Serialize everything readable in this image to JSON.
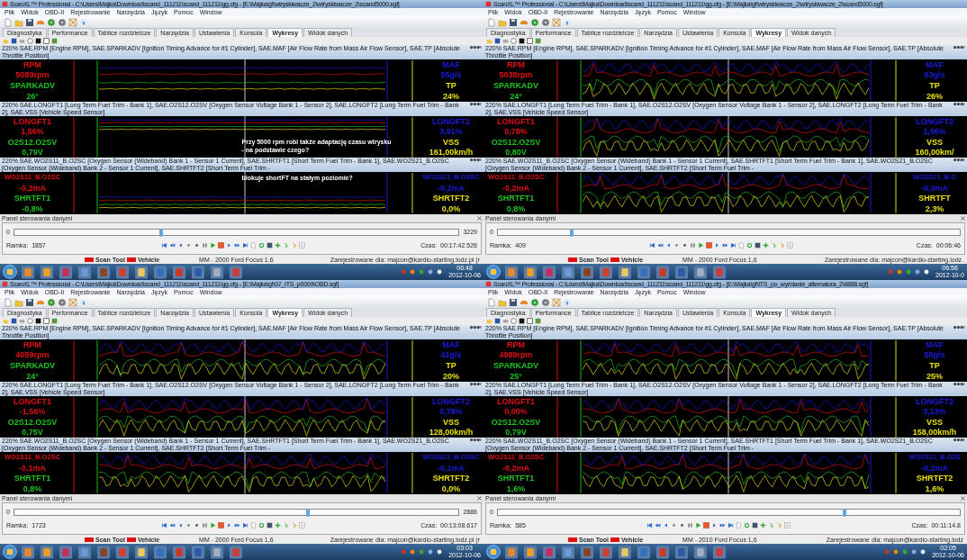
{
  "screens": [
    {
      "title": "ScanXL™ Professional - C:\\Users\\Majka\\Download\\scand_111211\\scand_111211\\gg.cfg - [E:\\Majka\\gf\\wtryskiwacze_2\\wtryskiwacze_2\\scand5000.sgf]",
      "menu": [
        "Plik",
        "Widok",
        "OBD-II",
        "Rejestrowanie",
        "Narzędzia",
        "Język",
        "Pomoc",
        "Window"
      ],
      "tabs": [
        {
          "label": "Diagnostyka",
          "selected": false
        },
        {
          "label": "Performance",
          "selected": false
        },
        {
          "label": "Tablice rozdzielcze",
          "selected": false
        },
        {
          "label": "Narzędzia",
          "selected": false
        },
        {
          "label": "Ustawienia",
          "selected": false
        },
        {
          "label": "Konsola",
          "selected": false
        },
        {
          "label": "Wykresy",
          "selected": true
        },
        {
          "label": "Widok danych",
          "selected": false
        }
      ],
      "charts": [
        {
          "header": "220% SAE.RPM [Engine RPM], SAE.SPARKADV [Ignition Timing Advance for #1 Cylinder], SAE.MAF [Air Flow Rate from Mass Air Flow Sensor], SAE.TP [Absolute Throttle Position]",
          "left": [
            {
              "text": "RPM",
              "color": "#e01010"
            },
            {
              "text": "5089rpm",
              "color": "#e01010"
            },
            {
              "text": "SPARKADV",
              "color": "#20c020"
            },
            {
              "text": "26°",
              "color": "#20c020"
            }
          ],
          "right": [
            {
              "text": "MAF",
              "color": "#1a1ae0"
            },
            {
              "text": "55g/s",
              "color": "#1a1ae0"
            },
            {
              "text": "TP",
              "color": "#e8e010"
            },
            {
              "text": "24%",
              "color": "#e8e010"
            }
          ]
        },
        {
          "header": "220% SAE.LONGFT1 [Long Term Fuel Trim - Bank 1], SAE.O2S12.O2SV [Oxygen Sensor Voltage Bank 1 - Sensor 2], SAE.LONGFT2 [Long Term Fuel Trim - Bank 2], SAE.VSS [Vehicle Speed Sensor]",
          "left": [
            {
              "text": "LONGFT1",
              "color": "#e01010"
            },
            {
              "text": "1,56%",
              "color": "#e01010"
            },
            {
              "text": "O2S12.O2SV",
              "color": "#20c020"
            },
            {
              "text": "0,79V",
              "color": "#20c020"
            }
          ],
          "right": [
            {
              "text": "LONGFT2",
              "color": "#1a1ae0"
            },
            {
              "text": "3,91%",
              "color": "#1a1ae0"
            },
            {
              "text": "VSS",
              "color": "#e8e010"
            },
            {
              "text": "161,00km/h",
              "color": "#e8e010"
            }
          ],
          "notes": [
            "Przy 5000 rpm robi także adaptację czasu wtrysku - na podstawie czego?"
          ]
        },
        {
          "header": "220% SAE.WO2S11_B.O2SC [Oxygen Sensor (Wideband) Bank 1 - Sensor 1 Current], SAE.SHRTFT1 [Short Term Fuel Trim - Bank 1], SAE.WO2S21_B.O2SC [Oxygen Sensor (Wideband) Bank 2 - Sensor 1 Current], SAE.SHRTFT2 [Short Term Fuel Trim -",
          "left": [
            {
              "text": "WO2S11_B.O2SC",
              "color": "#e01010"
            },
            {
              "text": "-0,2mA",
              "color": "#e01010"
            },
            {
              "text": "SHRTFT1",
              "color": "#20c020"
            },
            {
              "text": "-0,8%",
              "color": "#20c020"
            }
          ],
          "right": [
            {
              "text": "WO2S21_B.O2SC",
              "color": "#1a1ae0"
            },
            {
              "text": "-0,2mA",
              "color": "#1a1ae0"
            },
            {
              "text": "SHRTFT2",
              "color": "#e8e010"
            },
            {
              "text": "0,0%",
              "color": "#e8e010"
            }
          ],
          "notes": [
            "blokuje shortFT na stałym poziomie?"
          ]
        }
      ],
      "player": {
        "title": "Panel sterowania danymi",
        "min": "0",
        "max": "3229",
        "level": 0.33,
        "frame_label": "Ramka:",
        "frame": "1857",
        "time_label": "Czas:",
        "time": "00:17:42.526"
      },
      "status": {
        "legend": [
          "Scan Tool",
          "Vehicle"
        ],
        "vehicle": "MM - 2000 Ford Focus 1,6",
        "license": "Zarejestrowane dla: majcon@kardio-starting.lodz.pl (r"
      },
      "clock": {
        "time": "06:48",
        "date": "2012-10-06"
      }
    },
    {
      "title": "ScanXL™ Professional - C:\\Users\\Majka\\Download\\scand_111211\\scand_111211\\gg.cfg - [E:\\Majka\\gf\\wtryskiwacze_2\\wtryskiwacze_2\\scand5000.sgf]",
      "menu": [
        "Plik",
        "Widok",
        "OBD-II",
        "Rejestrowanie",
        "Narzędzia",
        "Język",
        "Pomoc",
        "Window"
      ],
      "tabs": [
        {
          "label": "Diagnostyka",
          "selected": false
        },
        {
          "label": "Performance",
          "selected": false
        },
        {
          "label": "Tablice rozdzielcze",
          "selected": false
        },
        {
          "label": "Narzędzia",
          "selected": false
        },
        {
          "label": "Ustawienia",
          "selected": false
        },
        {
          "label": "Konsola",
          "selected": false
        },
        {
          "label": "Wykresy",
          "selected": true
        },
        {
          "label": "Widok danych",
          "selected": false
        }
      ],
      "charts": [
        {
          "header": "220% SAE.RPM [Engine RPM], SAE.SPARKADV [Ignition Timing Advance for #1 Cylinder], SAE.MAF [Air Flow Rate from Mass Air Flow Sensor], SAE.TP [Absolute Throttle Position]",
          "left": [
            {
              "text": "RPM",
              "color": "#e01010"
            },
            {
              "text": "5038rpm",
              "color": "#e01010"
            },
            {
              "text": "SPARKADV",
              "color": "#20c020"
            },
            {
              "text": "24°",
              "color": "#20c020"
            }
          ],
          "right": [
            {
              "text": "MAF",
              "color": "#1a1ae0"
            },
            {
              "text": "63g/s",
              "color": "#1a1ae0"
            },
            {
              "text": "TP",
              "color": "#e8e010"
            },
            {
              "text": "26%",
              "color": "#e8e010"
            }
          ]
        },
        {
          "header": "220% SAE.LONGFT1 [Long Term Fuel Trim - Bank 1], SAE.O2S12.O2SV [Oxygen Sensor Voltage Bank 1 - Sensor 2], SAE.LONGFT2 [Long Term Fuel Trim - Bank 2], SAE.VSS [Vehicle Speed Sensor]",
          "left": [
            {
              "text": "LONGFT1",
              "color": "#e01010"
            },
            {
              "text": "0,78%",
              "color": "#e01010"
            },
            {
              "text": "O2S12.O2SV",
              "color": "#20c020"
            },
            {
              "text": "0,80V",
              "color": "#20c020"
            }
          ],
          "right": [
            {
              "text": "LONGFT2",
              "color": "#1a1ae0"
            },
            {
              "text": "1,56%",
              "color": "#1a1ae0"
            },
            {
              "text": "VSS",
              "color": "#e8e010"
            },
            {
              "text": "160,00km/",
              "color": "#e8e010"
            }
          ]
        },
        {
          "header": "220% SAE.WO2S11_B.O2SC [Oxygen Sensor (Wideband) Bank 1 - Sensor 1 Current], SAE.SHRTFT1 [Short Term Fuel Trim - Bank 1], SAE.WO2S21_B.O2SC [Oxygen Sensor (Wideband) Bank 2 - Sensor 1 Current], SAE.SHRTFT2 [Short Term Fuel Trim -",
          "left": [
            {
              "text": "WO2S11_B.O2SC",
              "color": "#e01010"
            },
            {
              "text": "-0,2mA",
              "color": "#e01010"
            },
            {
              "text": "SHRTFT1",
              "color": "#20c020"
            },
            {
              "text": "0,8%",
              "color": "#20c020"
            }
          ],
          "right": [
            {
              "text": "WO2S21_B.O",
              "color": "#1a1ae0"
            },
            {
              "text": "-0,3mA",
              "color": "#1a1ae0"
            },
            {
              "text": "SHRTFT",
              "color": "#e8e010"
            },
            {
              "text": "2,3%",
              "color": "#e8e010"
            }
          ]
        }
      ],
      "player": {
        "title": "Panel sterowania danymi",
        "min": "0",
        "level": 0.16,
        "frame_label": "Ramka:",
        "frame": "409",
        "time_label": "Czas:",
        "time": "00:06:46"
      },
      "status": {
        "legend": [
          "Scan Tool",
          "Vehicle"
        ],
        "vehicle": "MM - 2000 Ford Focus 1,6",
        "license": "Zarejestrowane dla: majcon@kardio-starting.lodz."
      },
      "clock": {
        "time": "06:56",
        "date": "2012-10-0"
      }
    },
    {
      "title": "ScanXL™ Professional - C:\\Users\\Majka\\Download\\scand_111211\\scand_111211\\gg.cfg - [E:\\Majka\\gf\\07_ITS_p0009\\OBD.sgf]",
      "menu": [
        "Plik",
        "Widok",
        "OBD-II",
        "Rejestrowanie",
        "Narzędzia",
        "Język",
        "Pomoc",
        "Window"
      ],
      "tabs": [
        {
          "label": "Diagnostyka",
          "selected": false
        },
        {
          "label": "Performance",
          "selected": false
        },
        {
          "label": "Tablice rozdzielcze",
          "selected": false
        },
        {
          "label": "Narzędzia",
          "selected": false
        },
        {
          "label": "Ustawienia",
          "selected": false
        },
        {
          "label": "Konsola",
          "selected": false
        },
        {
          "label": "Wykresy",
          "selected": true
        },
        {
          "label": "Widok danych",
          "selected": false
        }
      ],
      "charts": [
        {
          "header": "220% SAE.RPM [Engine RPM], SAE.SPARKADV [Ignition Timing Advance for #1 Cylinder], SAE.MAF [Air Flow Rate from Mass Air Flow Sensor], SAE.TP [Absolute Throttle Position]",
          "left": [
            {
              "text": "RPM",
              "color": "#e01010"
            },
            {
              "text": "4059rpm",
              "color": "#e01010"
            },
            {
              "text": "SPARKADV",
              "color": "#20c020"
            },
            {
              "text": "24°",
              "color": "#20c020"
            }
          ],
          "right": [
            {
              "text": "MAF",
              "color": "#1a1ae0"
            },
            {
              "text": "41g/s",
              "color": "#1a1ae0"
            },
            {
              "text": "TP",
              "color": "#e8e010"
            },
            {
              "text": "20%",
              "color": "#e8e010"
            }
          ]
        },
        {
          "header": "220% SAE.LONGFT1 [Long Term Fuel Trim - Bank 1], SAE.O2S12.O2SV [Oxygen Sensor Voltage Bank 1 - Sensor 2], SAE.LONGFT2 [Long Term Fuel Trim - Bank 2], SAE.VSS [Vehicle Speed Sensor]",
          "left": [
            {
              "text": "LONGFT1",
              "color": "#e01010"
            },
            {
              "text": "-1,56%",
              "color": "#e01010"
            },
            {
              "text": "O2S12.O2SV",
              "color": "#20c020"
            },
            {
              "text": "0,75V",
              "color": "#20c020"
            }
          ],
          "right": [
            {
              "text": "LONGFT2",
              "color": "#1a1ae0"
            },
            {
              "text": "0,78%",
              "color": "#1a1ae0"
            },
            {
              "text": "VSS",
              "color": "#e8e010"
            },
            {
              "text": "128,00km/h",
              "color": "#e8e010"
            }
          ]
        },
        {
          "header": "220% SAE.WO2S11_B.O2SC [Oxygen Sensor (Wideband) Bank 1 - Sensor 1 Current], SAE.SHRTFT1 [Short Term Fuel Trim - Bank 1], SAE.WO2S21_B.O2SC [Oxygen Sensor (Wideband) Bank 2 - Sensor 1 Current], SAE.SHRTFT2 [Short Term Fuel Trim -",
          "left": [
            {
              "text": "WO2S11_B.O2SC",
              "color": "#e01010"
            },
            {
              "text": "-0,1mA",
              "color": "#e01010"
            },
            {
              "text": "SHRTFT1",
              "color": "#20c020"
            },
            {
              "text": "0,8%",
              "color": "#20c020"
            }
          ],
          "right": [
            {
              "text": "WO2S21_B.O2SC",
              "color": "#1a1ae0"
            },
            {
              "text": "-0,1mA",
              "color": "#1a1ae0"
            },
            {
              "text": "SHRTFT2",
              "color": "#e8e010"
            },
            {
              "text": "0,0%",
              "color": "#e8e010"
            }
          ]
        }
      ],
      "player": {
        "title": "Panel sterowania danymi",
        "min": "0",
        "max": "2886",
        "level": 0.66,
        "frame_label": "Ramka:",
        "frame": "1723",
        "time_label": "Czas:",
        "time": "00:13:08.617"
      },
      "status": {
        "legend": [
          "Scan Tool",
          "Vehicle"
        ],
        "vehicle": "MM - 2000 Ford Focus 1,6",
        "license": "Zarejestrowane dla: majcon@kardio-starting.lodz.pl (r"
      },
      "clock": {
        "time": "03:03",
        "date": "2012-10-06"
      }
    },
    {
      "title": "ScanXL™ Professional - C:\\Users\\Majka\\Download\\scand_111211\\scand_111211\\gg.cfg - [E:\\Majka\\gf\\ITS_po_wymianie_alternatora_2\\4888.sgf]",
      "menu": [
        "Plik",
        "Widok",
        "OBD-II",
        "Rejestrowanie",
        "Narzędzia",
        "Język",
        "Pomoc",
        "Window"
      ],
      "tabs": [
        {
          "label": "Diagnostyka",
          "selected": false
        },
        {
          "label": "Performance",
          "selected": false
        },
        {
          "label": "Tablice rozdzielcze",
          "selected": false
        },
        {
          "label": "Narzędzia",
          "selected": false
        },
        {
          "label": "Ustawienia",
          "selected": false
        },
        {
          "label": "Konsola",
          "selected": false
        },
        {
          "label": "Wykresy",
          "selected": true
        },
        {
          "label": "Widok danych",
          "selected": false
        }
      ],
      "charts": [
        {
          "header": "220% SAE.RPM [Engine RPM], SAE.SPARKADV [Ignition Timing Advance for #1 Cylinder], SAE.MAF [Air Flow Rate from Mass Air Flow Sensor], SAE.TP [Absolute Throttle Position]",
          "left": [
            {
              "text": "RPM",
              "color": "#e01010"
            },
            {
              "text": "4989rpm",
              "color": "#e01010"
            },
            {
              "text": "SPARKADV",
              "color": "#20c020"
            },
            {
              "text": "25°",
              "color": "#20c020"
            }
          ],
          "right": [
            {
              "text": "MAF",
              "color": "#1a1ae0"
            },
            {
              "text": "56g/s",
              "color": "#1a1ae0"
            },
            {
              "text": "TP",
              "color": "#e8e010"
            },
            {
              "text": "25%",
              "color": "#e8e010"
            }
          ]
        },
        {
          "header": "220% SAE.LONGFT1 [Long Term Fuel Trim - Bank 1], SAE.O2S12.O2SV [Oxygen Sensor Voltage Bank 1 - Sensor 2], SAE.LONGFT2 [Long Term Fuel Trim - Bank 2], SAE.VSS [Vehicle Speed Sensor]",
          "left": [
            {
              "text": "LONGFT1",
              "color": "#e01010"
            },
            {
              "text": "0,00%",
              "color": "#e01010"
            },
            {
              "text": "O2S12.O2SV",
              "color": "#20c020"
            },
            {
              "text": "0,79V",
              "color": "#20c020"
            }
          ],
          "right": [
            {
              "text": "LONGFT2",
              "color": "#1a1ae0"
            },
            {
              "text": "3,13%",
              "color": "#1a1ae0"
            },
            {
              "text": "VSS",
              "color": "#e8e010"
            },
            {
              "text": "158,00km/h",
              "color": "#e8e010"
            }
          ]
        },
        {
          "header": "220% SAE.WO2S11_B.O2SC [Oxygen Sensor (Wideband) Bank 1 - Sensor 1 Current], SAE.SHRTFT1 [Short Term Fuel Trim - Bank 1], SAE.WO2S21_B.O2SC [Oxygen Sensor (Wideband) Bank 2 - Sensor 1 Current], SAE.SHRTFT2 [Short Term Fuel Trim -",
          "left": [
            {
              "text": "WO2S11_B.O2SC",
              "color": "#e01010"
            },
            {
              "text": "-0,2mA",
              "color": "#e01010"
            },
            {
              "text": "SHRTFT1",
              "color": "#20c020"
            },
            {
              "text": "1,6%",
              "color": "#20c020"
            }
          ],
          "right": [
            {
              "text": "WO2S21_B.O2S",
              "color": "#1a1ae0"
            },
            {
              "text": "-0,2mA",
              "color": "#1a1ae0"
            },
            {
              "text": "SHRTFT2",
              "color": "#e8e010"
            },
            {
              "text": "1,6%",
              "color": "#e8e010"
            }
          ]
        }
      ],
      "player": {
        "title": "Panel sterowania danymi",
        "min": "0",
        "level": 0.75,
        "frame_label": "Ramka:",
        "frame": "585",
        "time_label": "Czas:",
        "time": "00:11:14.8"
      },
      "status": {
        "legend": [
          "Scan Tool",
          "Vehicle"
        ],
        "vehicle": "MM - 2010 Ford Focus 1,6",
        "license": "Zarejestrowane dla: majcon@kardio-starting.lodz"
      },
      "clock": {
        "time": "02:05",
        "date": "2012-10-06"
      }
    }
  ]
}
